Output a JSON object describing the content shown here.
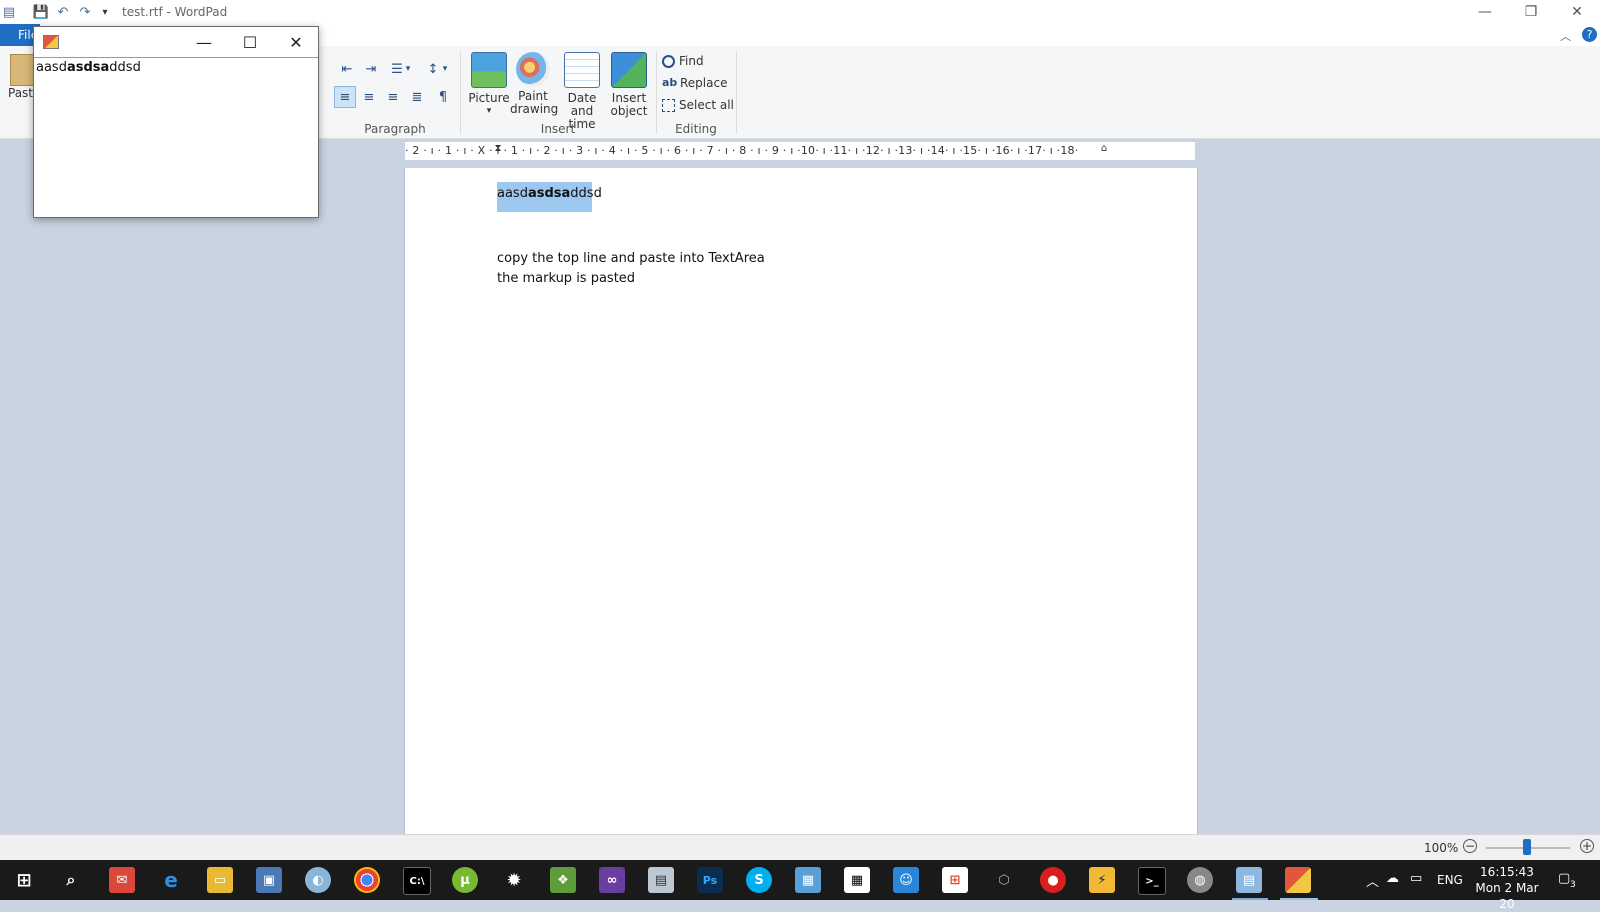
{
  "window": {
    "title": "test.rtf - WordPad",
    "controls": {
      "minimize": "—",
      "restore": "❐",
      "close": "✕"
    }
  },
  "ribbon": {
    "file_tab": "File",
    "paste_label": "Paste",
    "paragraph_label": "Paragraph",
    "insert_label": "Insert",
    "editing_label": "Editing",
    "insert_buttons": [
      {
        "line1": "Picture",
        "line2": "▾"
      },
      {
        "line1": "Paint",
        "line2": "drawing"
      },
      {
        "line1": "Date and",
        "line2": "time"
      },
      {
        "line1": "Insert",
        "line2": "object"
      }
    ],
    "editing_buttons": [
      "Find",
      "Replace",
      "Select all"
    ]
  },
  "ruler": {
    "text": "· 2 · ı · 1 · ı · X · ı · 1 · ı · 2 · ı · 3 · ı · 4 · ı · 5 · ı · 6 · ı · 7 · ı · 8 · ı · 9 · ı ·10· ı ·11· ı ·12· ı ·13· ı ·14· ı ·15· ı ·16· ı ·17· ı ·18·"
  },
  "document": {
    "line1_plain_a": "aasd",
    "line1_bold": "asdsa",
    "line1_plain_b": "ddsd",
    "line2": "copy the top line and paste into TextArea",
    "line3": "the markup is pasted"
  },
  "float_window": {
    "content_plain_a": "aasd",
    "content_bold": "asdsa",
    "content_plain_b": "ddsd",
    "controls": {
      "minimize": "—",
      "maximize": "☐",
      "close": "✕"
    }
  },
  "status": {
    "zoom": "100%",
    "minus": "−",
    "plus": "+"
  },
  "taskbar": {
    "lang": "ENG",
    "time": "16:15:43",
    "date": "Mon 2 Mar 20",
    "notifications": "3"
  },
  "colors": {
    "accent": "#1e6fc4",
    "selection": "#9cc7ee",
    "workspace": "#c9d3e2",
    "taskbar": "#1a1a1a"
  }
}
